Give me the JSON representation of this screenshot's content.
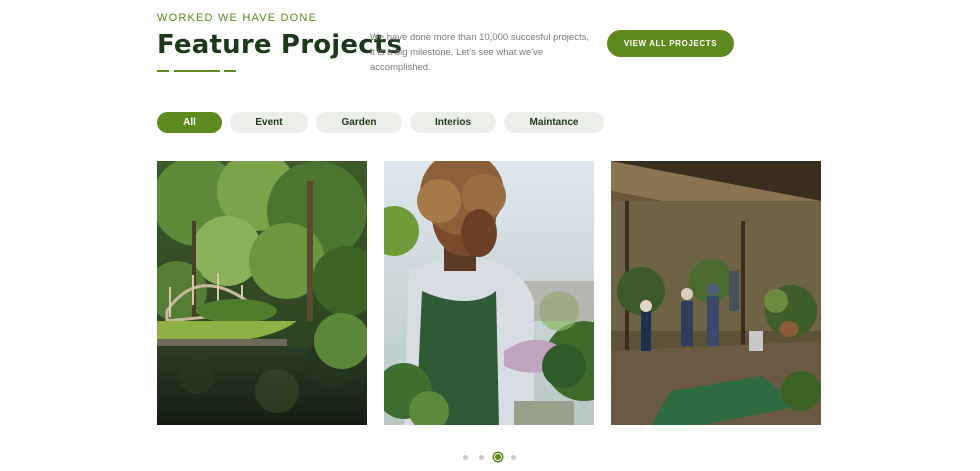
{
  "header": {
    "eyebrow": "WORKED WE HAVE DONE",
    "title": "Feature Projects",
    "description": "We have done more than 10,000 succesful projects, it is a big milestone. Let's see what we've accomplished.",
    "cta_label": "VIEW ALL PROJECTS"
  },
  "filters": [
    "All",
    "Event",
    "Garden",
    "Interios",
    "Maintance"
  ],
  "active_filter": "All",
  "projects": [
    {
      "image": "garden-pond-bridge-photo"
    },
    {
      "image": "woman-gardener-photo"
    },
    {
      "image": "garden-workers-photo"
    }
  ],
  "pagination": {
    "total": 4,
    "active": 3
  },
  "colors": {
    "accent": "#5e8a1f",
    "title": "#1c3a1a",
    "chip": "#eceee9"
  }
}
